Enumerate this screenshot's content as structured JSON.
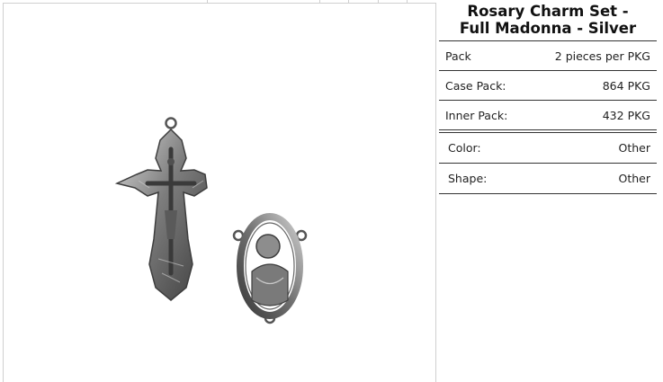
{
  "product": {
    "title_line1": "Rosary Charm Set -",
    "title_line2": "Full Madonna - Silver"
  },
  "image": {
    "icon": "rosary-charms-image"
  },
  "specs": [
    {
      "label": "Pack",
      "value": "2 pieces per PKG"
    },
    {
      "label": "Case Pack:",
      "value": "864 PKG"
    },
    {
      "label": "Inner Pack:",
      "value": "432 PKG"
    },
    {
      "label": "Color:",
      "value": "Other"
    },
    {
      "label": "Shape:",
      "value": "Other"
    }
  ],
  "colors": {
    "metal": "#8a8a8a",
    "border": "#333333"
  }
}
